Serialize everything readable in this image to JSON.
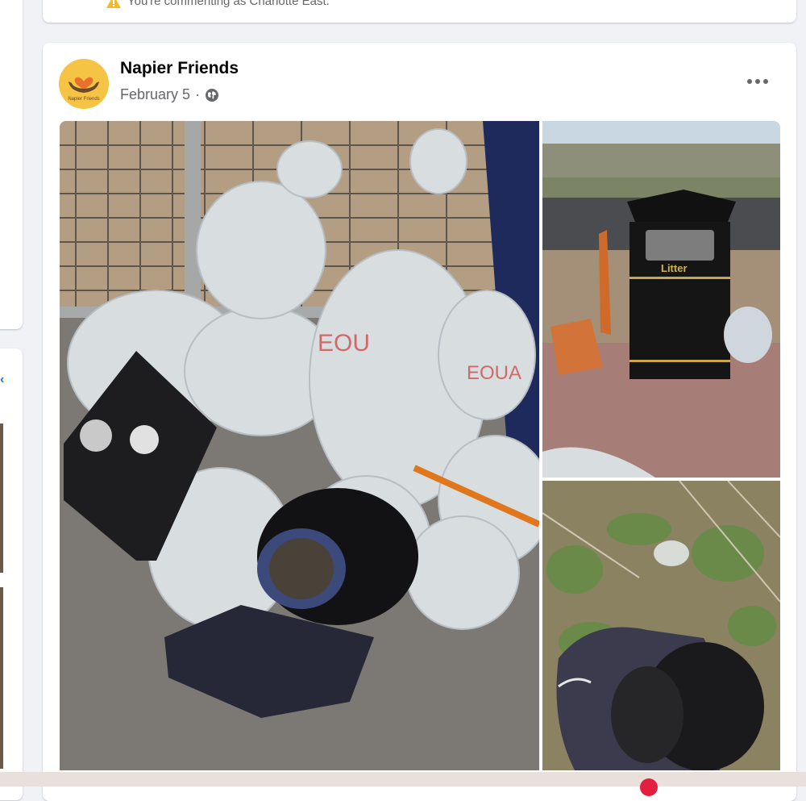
{
  "comment_bar": {
    "notice": "You're commenting as Charlotte East."
  },
  "post": {
    "page_name": "Napier Friends",
    "avatar_caption": "Napier Friends",
    "date": "February 5",
    "separator": "·",
    "privacy_icon": "globe-icon",
    "more_icon": "more-options-icon"
  },
  "photos": [
    {
      "name": "rubbish-bags-pile",
      "sign": "Litter"
    },
    {
      "name": "litter-bin-broken-chair"
    },
    {
      "name": "helmet-in-bag-hedge"
    }
  ],
  "colors": {
    "accent": "#1b74e4",
    "muted": "#65676b",
    "avatar_bg": "#f6c445"
  }
}
